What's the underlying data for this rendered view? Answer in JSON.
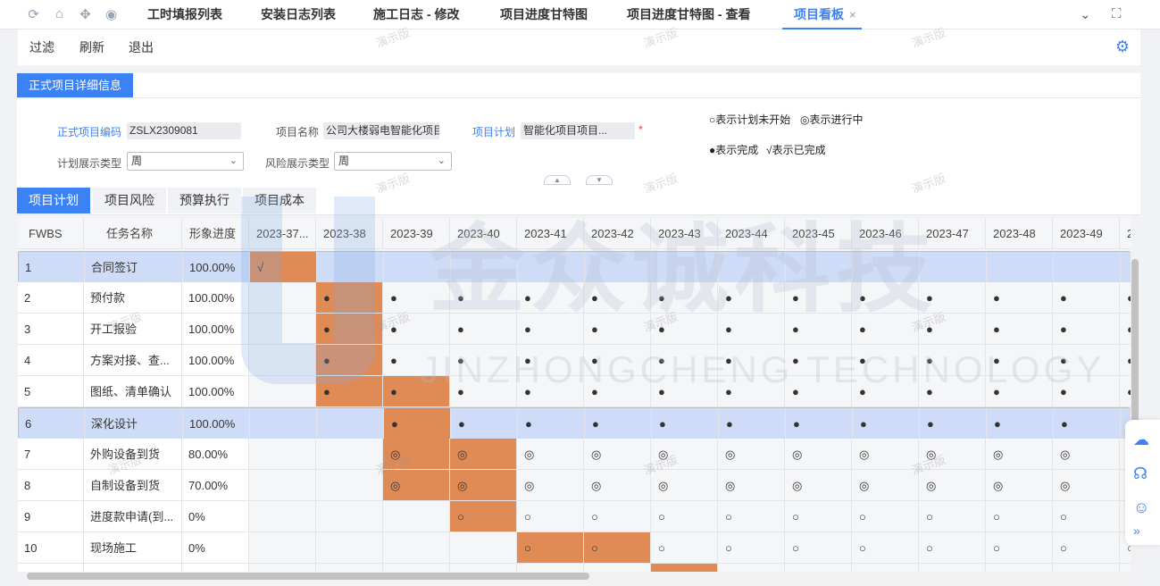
{
  "tabs": [
    {
      "label": "工时填报列表",
      "active": false
    },
    {
      "label": "安装日志列表",
      "active": false
    },
    {
      "label": "施工日志 - 修改",
      "active": false
    },
    {
      "label": "项目进度甘特图",
      "active": false
    },
    {
      "label": "项目进度甘特图 - 查看",
      "active": false
    },
    {
      "label": "项目看板",
      "active": true
    }
  ],
  "tab_close": "×",
  "toolbar": {
    "filter": "过滤",
    "refresh": "刷新",
    "exit": "退出"
  },
  "section_title": "正式项目详细信息",
  "form": {
    "code_label": "正式项目编码",
    "code_value": "ZSLX2309081",
    "name_label": "项目名称",
    "name_value": "公司大楼弱电智能化项目",
    "plan_label": "项目计划",
    "plan_value": "智能化项目项目...",
    "plan_type_label": "计划展示类型",
    "plan_type_value": "周",
    "risk_type_label": "风险展示类型",
    "risk_type_value": "周"
  },
  "legend": {
    "not_started": "○表示计划未开始",
    "in_progress": "◎表示进行中",
    "done": "●表示完成",
    "completed": "√表示已完成"
  },
  "grid_tabs": [
    "项目计划",
    "项目风险",
    "预算执行",
    "项目成本"
  ],
  "table": {
    "headers": [
      "FWBS",
      "任务名称",
      "形象进度"
    ],
    "weeks": [
      "2023-37...",
      "2023-38",
      "2023-39",
      "2023-40",
      "2023-41",
      "2023-42",
      "2023-43",
      "2023-44",
      "2023-45",
      "2023-46",
      "2023-47",
      "2023-48",
      "2023-49",
      "2"
    ],
    "rows": [
      {
        "fwbs": "1",
        "name": "合同签订",
        "progress": "100.00%",
        "marks": [
          "√",
          "",
          "",
          "",
          "",
          "",
          "",
          "",
          "",
          "",
          "",
          "",
          "",
          ""
        ],
        "bars": [
          0
        ],
        "selected": true
      },
      {
        "fwbs": "2",
        "name": "预付款",
        "progress": "100.00%",
        "marks": [
          "",
          "●",
          "●",
          "●",
          "●",
          "●",
          "●",
          "●",
          "●",
          "●",
          "●",
          "●",
          "●",
          "●"
        ],
        "bars": [
          1
        ],
        "selected": false
      },
      {
        "fwbs": "3",
        "name": "开工报验",
        "progress": "100.00%",
        "marks": [
          "",
          "●",
          "●",
          "●",
          "●",
          "●",
          "●",
          "●",
          "●",
          "●",
          "●",
          "●",
          "●",
          "●"
        ],
        "bars": [
          1
        ],
        "selected": false
      },
      {
        "fwbs": "4",
        "name": "方案对接、查...",
        "progress": "100.00%",
        "marks": [
          "",
          "●",
          "●",
          "●",
          "●",
          "●",
          "●",
          "●",
          "●",
          "●",
          "●",
          "●",
          "●",
          "●"
        ],
        "bars": [
          1
        ],
        "selected": false
      },
      {
        "fwbs": "5",
        "name": "图纸、清单确认",
        "progress": "100.00%",
        "marks": [
          "",
          "●",
          "●",
          "●",
          "●",
          "●",
          "●",
          "●",
          "●",
          "●",
          "●",
          "●",
          "●",
          "●"
        ],
        "bars": [
          1,
          2
        ],
        "selected": false
      },
      {
        "fwbs": "6",
        "name": "深化设计",
        "progress": "100.00%",
        "marks": [
          "",
          "",
          "●",
          "●",
          "●",
          "●",
          "●",
          "●",
          "●",
          "●",
          "●",
          "●",
          "●",
          "●"
        ],
        "bars": [
          2
        ],
        "selected": true
      },
      {
        "fwbs": "7",
        "name": "外购设备到货",
        "progress": "80.00%",
        "marks": [
          "",
          "",
          "◎",
          "◎",
          "◎",
          "◎",
          "◎",
          "◎",
          "◎",
          "◎",
          "◎",
          "◎",
          "◎",
          "◎"
        ],
        "bars": [
          2,
          3
        ],
        "selected": false
      },
      {
        "fwbs": "8",
        "name": "自制设备到货",
        "progress": "70.00%",
        "marks": [
          "",
          "",
          "◎",
          "◎",
          "◎",
          "◎",
          "◎",
          "◎",
          "◎",
          "◎",
          "◎",
          "◎",
          "◎",
          "◎"
        ],
        "bars": [
          2,
          3
        ],
        "selected": false
      },
      {
        "fwbs": "9",
        "name": "进度款申请(到...",
        "progress": "0%",
        "marks": [
          "",
          "",
          "",
          "○",
          "○",
          "○",
          "○",
          "○",
          "○",
          "○",
          "○",
          "○",
          "○",
          "○"
        ],
        "bars": [
          3
        ],
        "selected": false
      },
      {
        "fwbs": "10",
        "name": "现场施工",
        "progress": "0%",
        "marks": [
          "",
          "",
          "",
          "",
          "○",
          "○",
          "○",
          "○",
          "○",
          "○",
          "○",
          "○",
          "○",
          "○"
        ],
        "bars": [
          4,
          5
        ],
        "selected": false
      },
      {
        "fwbs": "",
        "name": "",
        "progress": "",
        "marks": [
          "",
          "",
          "",
          "",
          "",
          "",
          "",
          "",
          "",
          "",
          "",
          "",
          "",
          ""
        ],
        "bars": [
          6
        ],
        "selected": false
      }
    ]
  },
  "watermark": "演示版",
  "brand_watermark": "金众诚科技",
  "brand_watermark_en": "JINZHONGCHENG TECHNOLOGY",
  "accent_color": "#3b82f6",
  "bar_color": "#e08a55"
}
